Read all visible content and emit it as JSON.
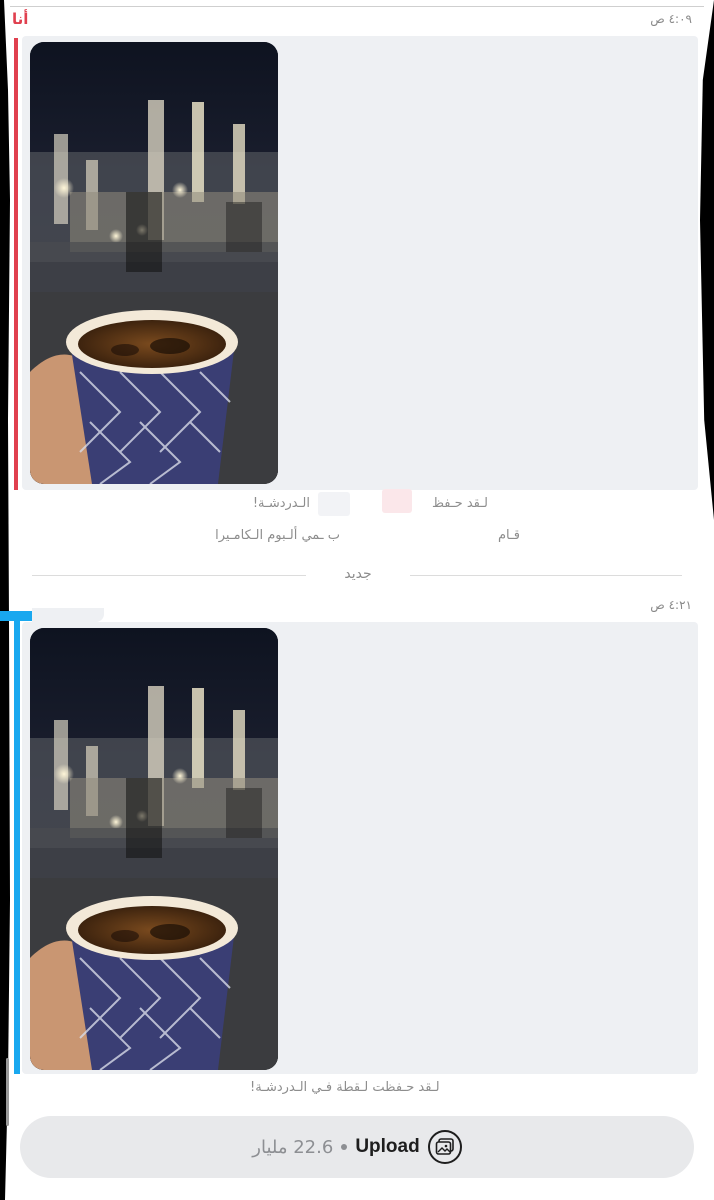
{
  "colors": {
    "sender_me": "#e0404f",
    "bar_me": "#e0404f",
    "bar_other": "#19a8ef",
    "card_bg": "#eef0f3",
    "pill_bg": "#e8e9eb"
  },
  "chat": {
    "first": {
      "sender": "أنا",
      "time": "٤:٠٩ ص",
      "media": "snap-photo-coffee-mosque"
    },
    "saved_notice_1a": "لـقد حـفظ",
    "saved_notice_1b": "الـدردشـة!",
    "saved_notice_2a": "قـام",
    "saved_notice_2b": "ب ـمي ألـبوم الـكامـيرا",
    "divider": "جديد",
    "second": {
      "time": "٤:٢١ ص",
      "media": "snap-photo-coffee-mosque"
    },
    "saved_notice_3": "لـقد حـفظت لـقطة فـي الـدردشـة!"
  },
  "upload": {
    "size": "22.6 مليار",
    "label": "Upload",
    "icon": "gallery-upload-icon"
  }
}
